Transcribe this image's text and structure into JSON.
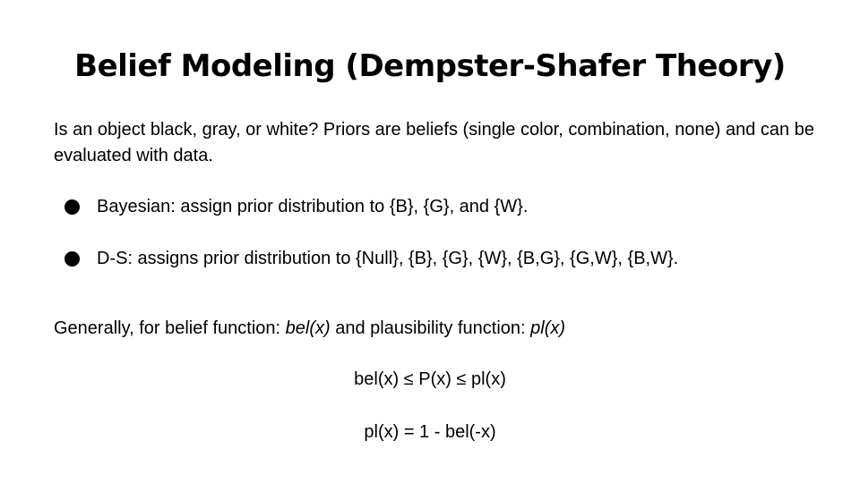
{
  "slide": {
    "title": "Belief Modeling (Dempster-Shafer Theory)",
    "intro": "Is an object black, gray, or white? Priors are beliefs (single color, combination, none) and can be evaluated with data.",
    "bullets": [
      {
        "text": "Bayesian: assign prior distribution to {B}, {G}, and {W}."
      },
      {
        "text": "D-S: assigns prior distribution to {Null}, {B}, {G}, {W}, {B,G}, {G,W}, {B,W}."
      }
    ],
    "generally": {
      "prefix": "Generally, for belief function: ",
      "belief_fn": "bel(x)",
      "middle": " and plausibility function: ",
      "plausibility_fn": "pl(x)"
    },
    "formulas": [
      "bel(x) ≤ P(x) ≤ pl(x)",
      "pl(x) = 1 - bel(-x)"
    ]
  },
  "colors": {
    "background": "#ffffff",
    "text": "#000000"
  }
}
